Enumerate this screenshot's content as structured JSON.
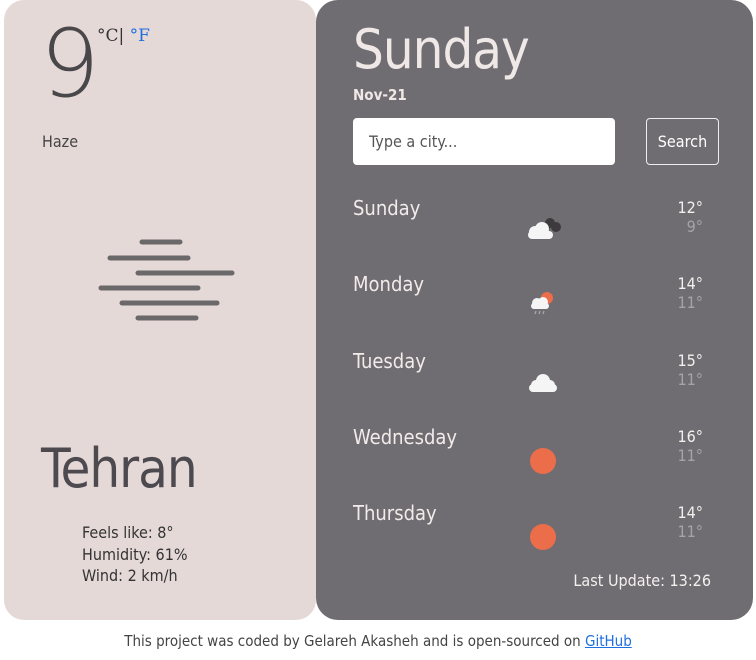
{
  "current": {
    "temperature": "9",
    "unit_c": "°C",
    "unit_sep": "|",
    "unit_f": "°F",
    "description": "Haze",
    "icon": "haze-icon",
    "city": "Tehran",
    "feels_like": "Feels like: 8°",
    "humidity": "Humidity: 61%",
    "wind": "Wind: 2 km/h"
  },
  "header": {
    "day": "Sunday",
    "date": "Nov-21"
  },
  "search": {
    "placeholder": "Type a city...",
    "button_label": "Search"
  },
  "forecast": [
    {
      "day": "Sunday",
      "max": "12°",
      "min": "9°",
      "icon": "clouds-icon"
    },
    {
      "day": "Monday",
      "max": "14°",
      "min": "11°",
      "icon": "sun-rain-icon"
    },
    {
      "day": "Tuesday",
      "max": "15°",
      "min": "11°",
      "icon": "cloud-icon"
    },
    {
      "day": "Wednesday",
      "max": "16°",
      "min": "11°",
      "icon": "sun-icon"
    },
    {
      "day": "Thursday",
      "max": "14°",
      "min": "11°",
      "icon": "sun-icon"
    }
  ],
  "last_update": "Last Update: 13:26",
  "footer": {
    "text": "This project was coded by Gelareh Akasheh and is open-sourced on ",
    "link": "GitHub"
  },
  "colors": {
    "left_bg": "#e5d9d8",
    "right_bg": "#706d72",
    "sun": "#ec6d4a",
    "link": "#1e6fe0"
  }
}
